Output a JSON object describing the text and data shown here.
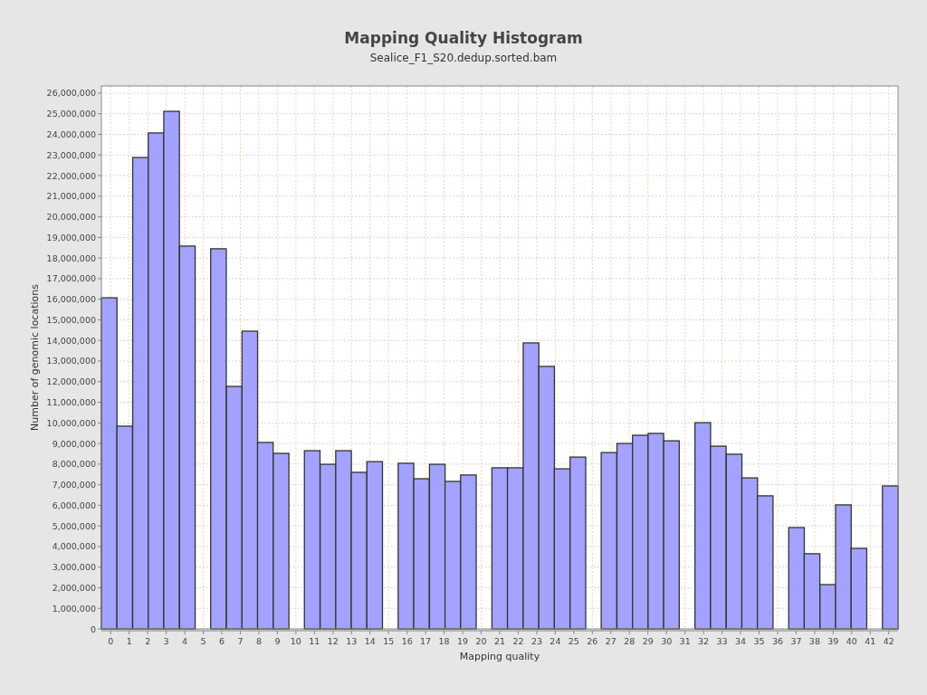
{
  "chart": {
    "subtitle": "Sealice_F1_S20.dedup.sorted.bam",
    "chart_data": {
      "type": "bar",
      "title": "Mapping Quality Histogram",
      "xlabel": "Mapping quality",
      "ylabel": "Number of genomic locations",
      "grid": true,
      "x": [
        -0.08,
        0.76,
        1.61,
        2.45,
        3.29,
        4.14,
        4.98,
        5.82,
        6.67,
        7.51,
        8.35,
        9.2,
        10.04,
        10.88,
        11.73,
        12.57,
        13.41,
        14.25,
        15.1,
        15.94,
        16.78,
        17.63,
        18.47,
        19.31,
        20.16,
        21.0,
        21.84,
        22.69,
        23.53,
        24.37,
        25.22,
        26.06,
        26.9,
        27.75,
        28.59,
        29.43,
        30.27,
        31.12,
        31.96,
        32.8,
        33.65,
        34.49,
        35.33,
        36.18,
        37.02,
        37.86,
        38.71,
        39.55,
        40.39,
        41.24,
        42.08
      ],
      "series": [
        {
          "color": "#a3a3ff",
          "values": [
            16070000,
            9840000,
            22880000,
            24070000,
            25120000,
            18580000,
            null,
            18450000,
            11770000,
            14450000,
            9050000,
            8520000,
            null,
            8650000,
            7990000,
            8650000,
            7600000,
            8120000,
            null,
            8040000,
            7290000,
            7990000,
            7160000,
            7470000,
            null,
            7820000,
            7820000,
            13880000,
            12740000,
            7770000,
            8340000,
            null,
            8560000,
            9000000,
            9400000,
            9490000,
            9130000,
            null,
            10010000,
            8870000,
            8480000,
            7330000,
            6460000,
            null,
            4920000,
            3650000,
            2150000,
            6020000,
            3910000,
            null,
            6940000
          ]
        }
      ],
      "xlim": [
        -0.5,
        42.5
      ],
      "ylim": [
        0,
        26350000
      ],
      "xticks": [
        0,
        1,
        2,
        3,
        4,
        5,
        6,
        7,
        8,
        9,
        10,
        11,
        12,
        13,
        14,
        15,
        16,
        17,
        18,
        19,
        20,
        21,
        22,
        23,
        24,
        25,
        26,
        27,
        28,
        29,
        30,
        31,
        32,
        33,
        34,
        35,
        36,
        37,
        38,
        39,
        40,
        41,
        42
      ],
      "yticks": [
        0,
        {
          "value": 1000000,
          "label": "1,000,000"
        },
        {
          "value": 2000000,
          "label": "2,000,000"
        },
        {
          "value": 3000000,
          "label": "3,000,000"
        },
        {
          "value": 4000000,
          "label": "4,000,000"
        },
        {
          "value": 5000000,
          "label": "5,000,000"
        },
        {
          "value": 6000000,
          "label": "6,000,000"
        },
        {
          "value": 7000000,
          "label": "7,000,000"
        },
        {
          "value": 8000000,
          "label": "8,000,000"
        },
        {
          "value": 9000000,
          "label": "9,000,000"
        },
        {
          "value": 10000000,
          "label": "10,000,000"
        },
        {
          "value": 11000000,
          "label": "11,000,000"
        },
        {
          "value": 12000000,
          "label": "12,000,000"
        },
        {
          "value": 13000000,
          "label": "13,000,000"
        },
        {
          "value": 14000000,
          "label": "14,000,000"
        },
        {
          "value": 15000000,
          "label": "15,000,000"
        },
        {
          "value": 16000000,
          "label": "16,000,000"
        },
        {
          "value": 17000000,
          "label": "17,000,000"
        },
        {
          "value": 18000000,
          "label": "18,000,000"
        },
        {
          "value": 19000000,
          "label": "19,000,000"
        },
        {
          "value": 20000000,
          "label": "20,000,000"
        },
        {
          "value": 21000000,
          "label": "21,000,000"
        },
        {
          "value": 22000000,
          "label": "22,000,000"
        },
        {
          "value": 23000000,
          "label": "23,000,000"
        },
        {
          "value": 24000000,
          "label": "24,000,000"
        },
        {
          "value": 25000000,
          "label": "25,000,000"
        },
        {
          "value": 26000000,
          "label": "26,000,000"
        }
      ]
    }
  }
}
